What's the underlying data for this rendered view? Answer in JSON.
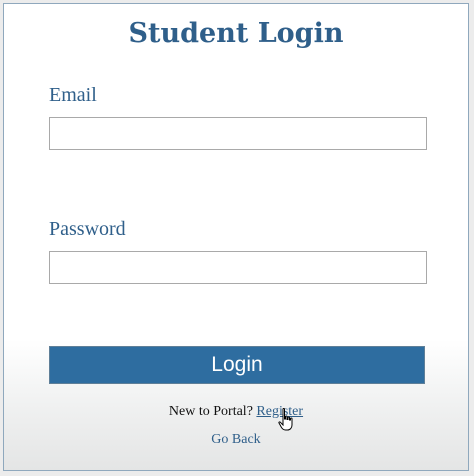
{
  "form": {
    "title": "Student Login",
    "email_label": "Email",
    "email_value": "",
    "password_label": "Password",
    "password_value": "",
    "login_label": "Login",
    "register_prompt": "New to Portal?",
    "register_link": "Register",
    "go_back": "Go Back"
  },
  "colors": {
    "accent": "#2f5f8a",
    "button": "#2e6da0",
    "border": "#8fa8bd"
  },
  "icons": {
    "cursor": "hand-pointer-icon"
  }
}
